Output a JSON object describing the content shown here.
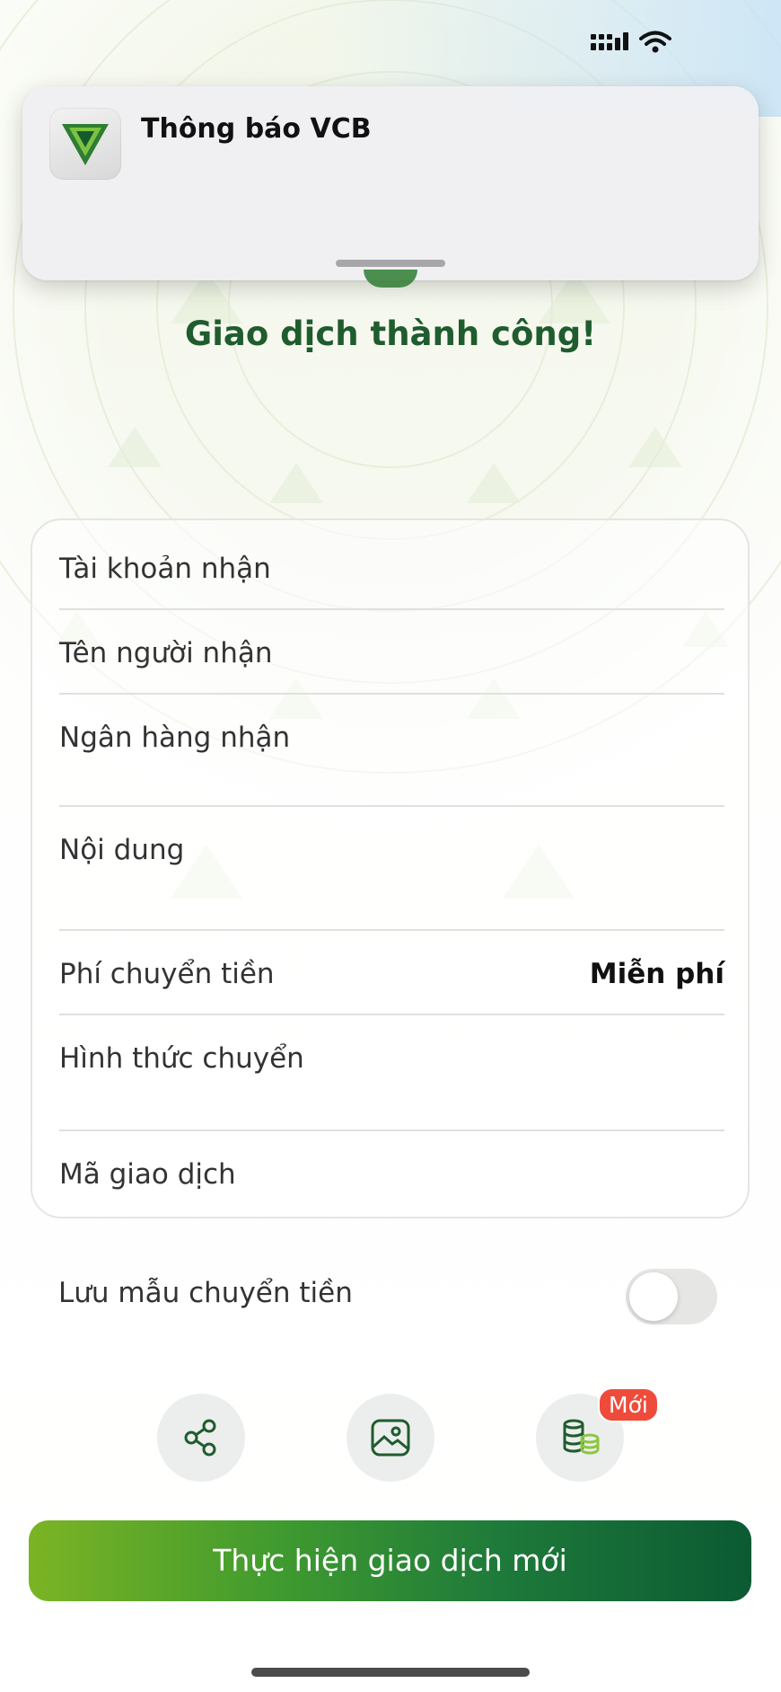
{
  "notification": {
    "title": "Thông báo VCB",
    "app_icon": "vcb-logo-icon"
  },
  "status_bar": {
    "icons": [
      "signal-icon",
      "wifi-icon"
    ]
  },
  "success": {
    "title": "Giao dịch thành công!"
  },
  "details": {
    "rows": [
      {
        "label": "Tài khoản nhận",
        "value": ""
      },
      {
        "label": "Tên người nhận",
        "value": ""
      },
      {
        "label": "Ngân hàng nhận",
        "value": ""
      },
      {
        "label": "Nội dung",
        "value": ""
      },
      {
        "label": "Phí chuyển tiền",
        "value": "Miễn phí"
      },
      {
        "label": "Hình thức chuyển",
        "value": ""
      },
      {
        "label": "Mã giao dịch",
        "value": ""
      }
    ]
  },
  "save_template": {
    "label": "Lưu mẫu chuyển tiền",
    "enabled": false
  },
  "actions": {
    "items": [
      {
        "icon": "share-icon"
      },
      {
        "icon": "image-icon"
      },
      {
        "icon": "coins-icon",
        "badge": "Mới"
      }
    ]
  },
  "primary_button": {
    "label": "Thực hiện giao dịch mới"
  },
  "colors": {
    "brand_green": "#1f5c2e",
    "button_gradient_start": "#7bb424",
    "button_gradient_end": "#0b5a33",
    "badge_red": "#ee4b3b"
  }
}
